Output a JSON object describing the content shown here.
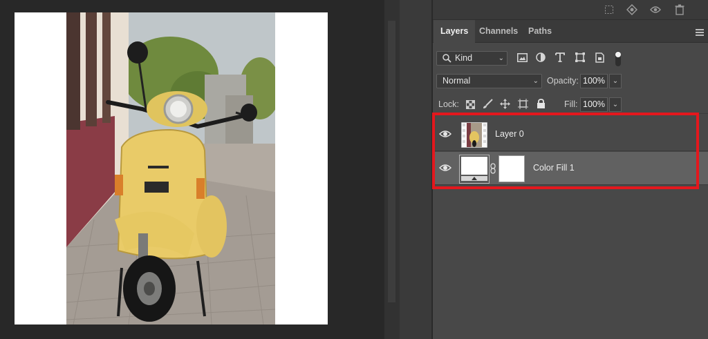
{
  "panel": {
    "tabs": [
      {
        "label": "Layers"
      },
      {
        "label": "Channels"
      },
      {
        "label": "Paths"
      }
    ],
    "filter": {
      "kind_label": "Kind"
    },
    "blend": {
      "mode": "Normal",
      "opacity_label": "Opacity:",
      "opacity_value": "100%"
    },
    "lock": {
      "label": "Lock:",
      "fill_label": "Fill:",
      "fill_value": "100%"
    },
    "layers": [
      {
        "name": "Layer 0",
        "visible": true,
        "selected": false
      },
      {
        "name": "Color Fill 1",
        "visible": true,
        "selected": true
      }
    ]
  },
  "icons": {
    "top_bar": [
      "selection-icon",
      "fill-adjust-icon",
      "visibility-icon",
      "trash-icon"
    ],
    "filters": [
      "image-filter-icon",
      "adjustment-filter-icon",
      "type-filter-icon",
      "shape-filter-icon",
      "smart-object-filter-icon",
      "filter-toggle-icon"
    ],
    "locks": [
      "lock-transparent-icon",
      "lock-brush-icon",
      "lock-move-icon",
      "lock-artboard-icon",
      "lock-all-icon"
    ]
  },
  "colors": {
    "highlight": "#e4171d",
    "panel_bg": "#484848",
    "selected_row": "#616161",
    "canvas_bg": "#282828"
  }
}
